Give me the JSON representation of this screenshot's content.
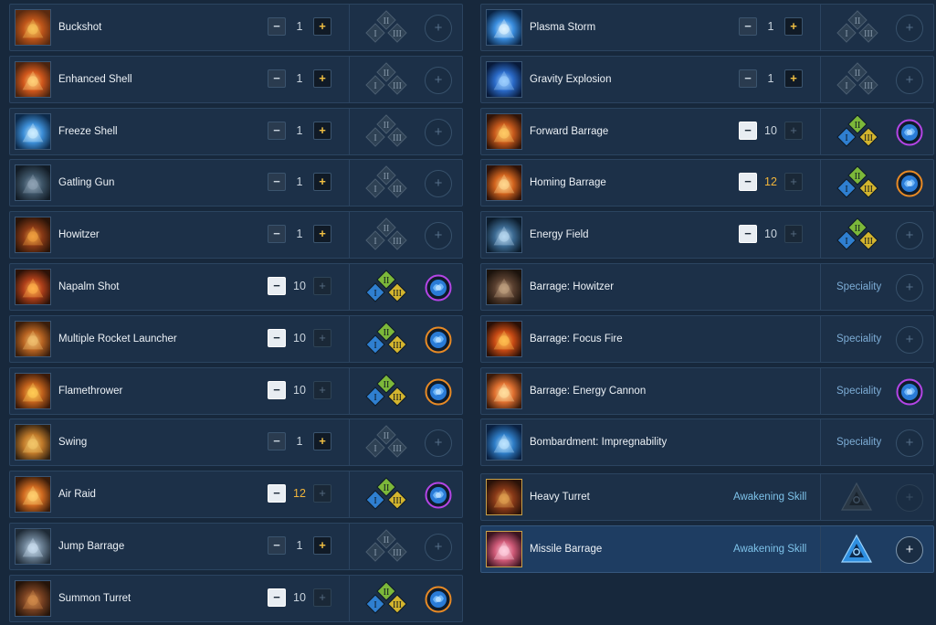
{
  "speciality_label": "Speciality",
  "awakening_label": "Awakening Skill",
  "colors": {
    "background": "#17283c",
    "row": "#1c3048",
    "row_selected": "#1e3d62",
    "gold": "#f0b43a",
    "speciality_text": "#7dadd6",
    "awakening_text": "#7ec3ea",
    "rune_purple": "#b445e6",
    "rune_orange": "#e88a25",
    "tripod_blue": "#2f7fd0",
    "tripod_green": "#7cb83a",
    "tripod_gold": "#d4b52e"
  },
  "left_column": [
    {
      "name": "Buckshot",
      "icon": "buckshot-icon",
      "level": "1",
      "tripods_active": false,
      "rune": "none"
    },
    {
      "name": "Enhanced Shell",
      "icon": "enhanced-shell-icon",
      "level": "1",
      "tripods_active": false,
      "rune": "none"
    },
    {
      "name": "Freeze Shell",
      "icon": "freeze-shell-icon",
      "level": "1",
      "tripods_active": false,
      "rune": "none"
    },
    {
      "name": "Gatling Gun",
      "icon": "gatling-gun-icon",
      "level": "1",
      "tripods_active": false,
      "rune": "none"
    },
    {
      "name": "Howitzer",
      "icon": "howitzer-icon",
      "level": "1",
      "tripods_active": false,
      "rune": "none"
    },
    {
      "name": "Napalm Shot",
      "icon": "napalm-shot-icon",
      "level": "10",
      "tripods_active": true,
      "rune": "purple"
    },
    {
      "name": "Multiple Rocket Launcher",
      "icon": "multiple-rocket-launcher-icon",
      "level": "10",
      "tripods_active": true,
      "rune": "orange"
    },
    {
      "name": "Flamethrower",
      "icon": "flamethrower-icon",
      "level": "10",
      "tripods_active": true,
      "rune": "orange"
    },
    {
      "name": "Swing",
      "icon": "swing-icon",
      "level": "1",
      "tripods_active": false,
      "rune": "none"
    },
    {
      "name": "Air Raid",
      "icon": "air-raid-icon",
      "level": "12",
      "tripods_active": true,
      "rune": "purple"
    },
    {
      "name": "Jump Barrage",
      "icon": "jump-barrage-icon",
      "level": "1",
      "tripods_active": false,
      "rune": "none"
    },
    {
      "name": "Summon Turret",
      "icon": "summon-turret-icon",
      "level": "10",
      "tripods_active": true,
      "rune": "orange"
    }
  ],
  "right_column": [
    {
      "name": "Plasma Storm",
      "icon": "plasma-storm-icon",
      "kind": "level",
      "level": "1",
      "tripods_active": false,
      "rune": "none"
    },
    {
      "name": "Gravity Explosion",
      "icon": "gravity-explosion-icon",
      "kind": "level",
      "level": "1",
      "tripods_active": false,
      "rune": "none"
    },
    {
      "name": "Forward Barrage",
      "icon": "forward-barrage-icon",
      "kind": "level",
      "level": "10",
      "tripods_active": true,
      "rune": "purple"
    },
    {
      "name": "Homing Barrage",
      "icon": "homing-barrage-icon",
      "kind": "level",
      "level": "12",
      "tripods_active": true,
      "rune": "orange"
    },
    {
      "name": "Energy Field",
      "icon": "energy-field-icon",
      "kind": "level",
      "level": "10",
      "tripods_active": true,
      "rune": "none"
    },
    {
      "name": "Barrage: Howitzer",
      "icon": "barrage-howitzer-icon",
      "kind": "speciality",
      "rune": "none"
    },
    {
      "name": "Barrage: Focus Fire",
      "icon": "barrage-focus-fire-icon",
      "kind": "speciality",
      "rune": "none"
    },
    {
      "name": "Barrage: Energy Cannon",
      "icon": "barrage-energy-cannon-icon",
      "kind": "speciality",
      "rune": "purple"
    },
    {
      "name": "Bombardment: Impregnability",
      "icon": "bombardment-impregnability-icon",
      "kind": "speciality",
      "rune": "none"
    },
    {
      "name": "Heavy Turret",
      "icon": "heavy-turret-icon",
      "kind": "awakening",
      "selected": false
    },
    {
      "name": "Missile Barrage",
      "icon": "missile-barrage-icon",
      "kind": "awakening",
      "selected": true
    }
  ]
}
